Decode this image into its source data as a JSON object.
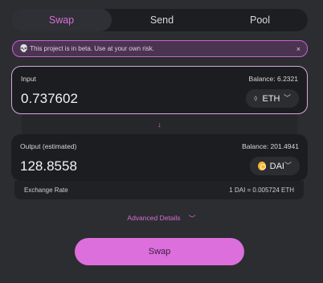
{
  "tabs": [
    {
      "label": "Swap"
    },
    {
      "label": "Send"
    },
    {
      "label": "Pool"
    }
  ],
  "banner": {
    "text": "This project is in beta. Use at your own risk.",
    "close": "×"
  },
  "input": {
    "label": "Input",
    "balance": "Balance: 6.2321",
    "amount": "0.737602",
    "token": "ETH"
  },
  "output": {
    "label": "Output (estimated)",
    "balance": "Balance: 201.4941",
    "amount": "128.8558",
    "token": "DAI"
  },
  "exchange": {
    "label": "Exchange Rate",
    "value": "1 DAI = 0.005724 ETH"
  },
  "advanced": {
    "label": "Advanced Details"
  },
  "swap_button": {
    "label": "Swap"
  },
  "icons": {
    "skull": "skull-icon",
    "close": "close-icon",
    "eth": "eth-icon",
    "dai": "dai-icon",
    "chevron": "chevron-down-icon",
    "arrow": "arrow-down-icon"
  },
  "colors": {
    "accent": "#dc6fdc",
    "background": "#2b2d30",
    "card": "#1c1d20",
    "dai": "#f4b731"
  }
}
